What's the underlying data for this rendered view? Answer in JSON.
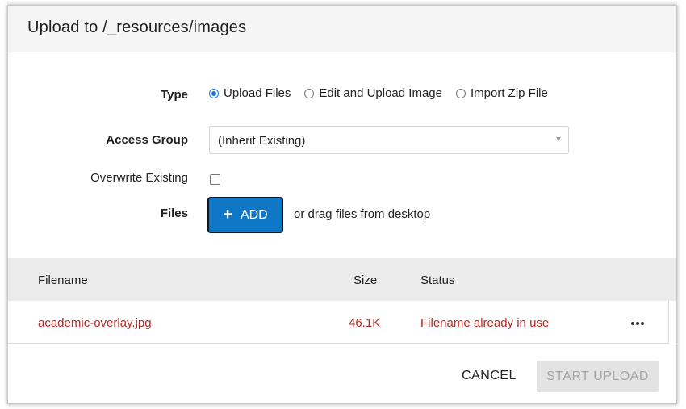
{
  "dialog": {
    "title": "Upload to /_resources/images"
  },
  "form": {
    "type_label": "Type",
    "type_options": [
      {
        "label": "Upload Files",
        "selected": true
      },
      {
        "label": "Edit and Upload Image",
        "selected": false
      },
      {
        "label": "Import Zip File",
        "selected": false
      }
    ],
    "access_group_label": "Access Group",
    "access_group_value": "(Inherit Existing)",
    "overwrite_label": "Overwrite Existing",
    "overwrite_checked": false,
    "files_label": "Files",
    "add_button_label": "ADD",
    "add_button_icon": "plus-icon",
    "drag_hint": "or drag files from desktop"
  },
  "table": {
    "columns": [
      "Filename",
      "Size",
      "Status"
    ],
    "rows": [
      {
        "filename": "academic-overlay.jpg",
        "size": "46.1K",
        "status": "Filename already in use"
      }
    ]
  },
  "footer": {
    "cancel_label": "CANCEL",
    "start_label": "START UPLOAD"
  },
  "colors": {
    "accent": "#0e78c7",
    "radio_selected": "#1670e6",
    "error": "#b52a22",
    "disabled_bg": "#e3e3e3",
    "disabled_text": "#a6a6a6"
  }
}
